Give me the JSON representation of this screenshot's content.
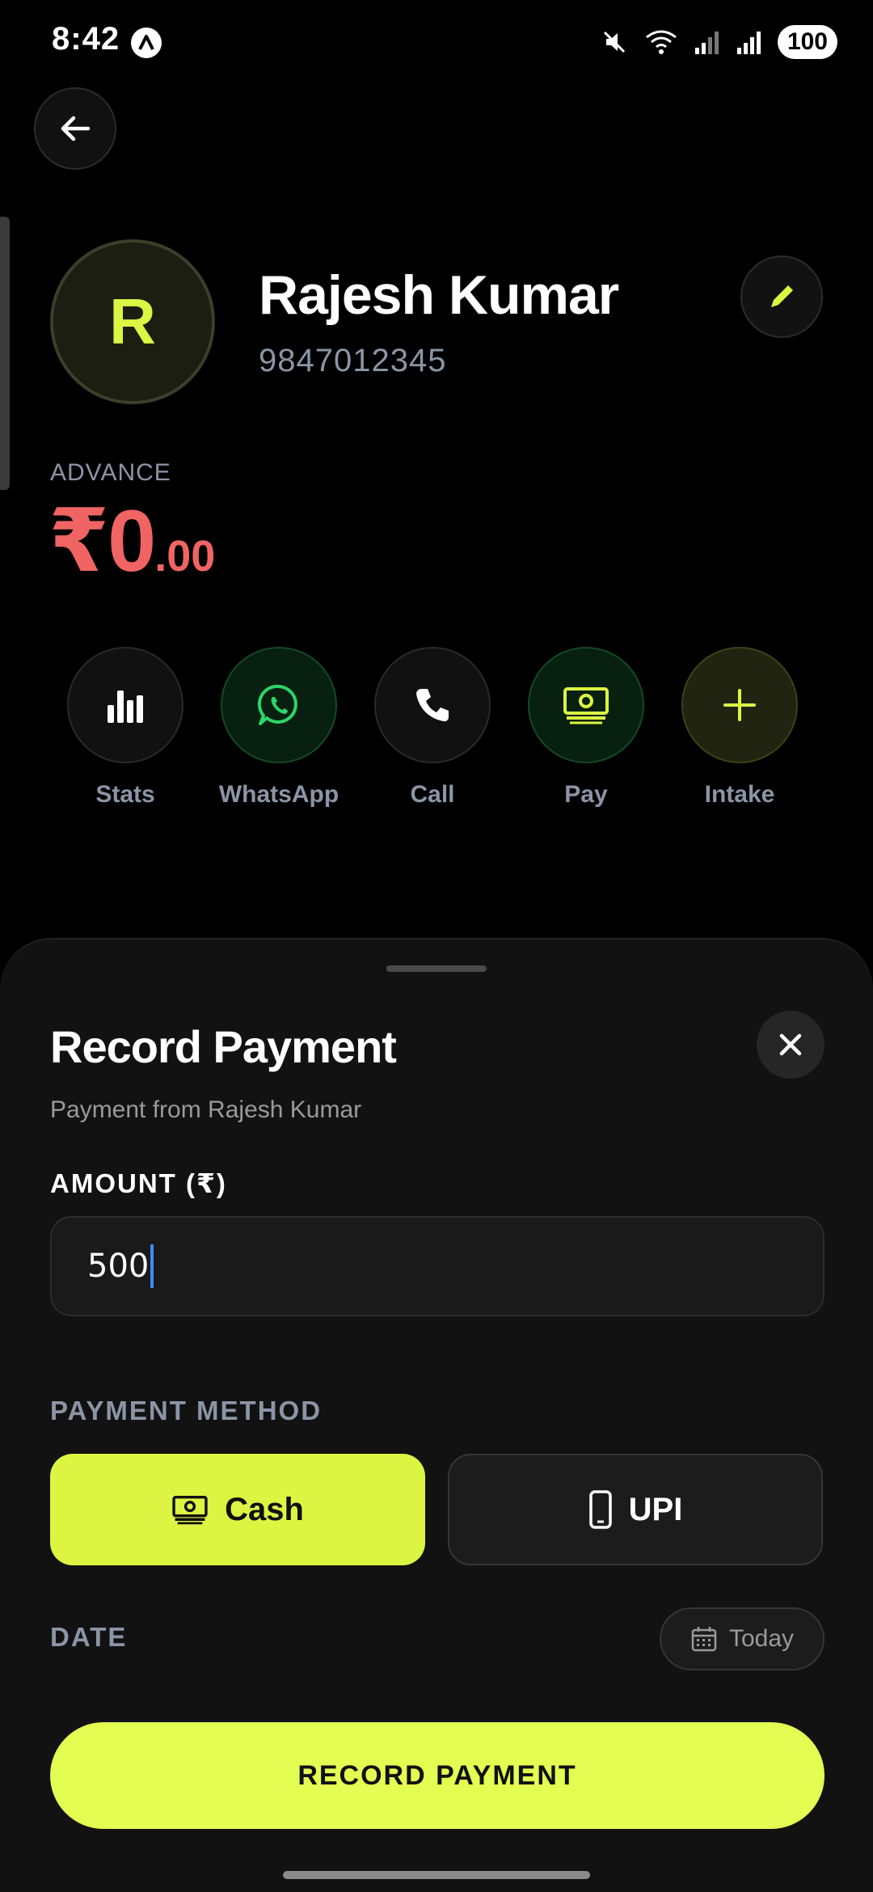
{
  "status_bar": {
    "time": "8:42",
    "battery": "100",
    "icons": [
      "mute-icon",
      "wifi-icon",
      "signal-icon",
      "signal-icon"
    ]
  },
  "customer": {
    "initial": "R",
    "name": "Rajesh Kumar",
    "phone": "9847012345"
  },
  "balance": {
    "label": "ADVANCE",
    "amount_main": "₹0",
    "amount_cents": ".00",
    "color": "#f06464"
  },
  "actions": [
    {
      "label": "Stats",
      "icon": "stats-icon"
    },
    {
      "label": "WhatsApp",
      "icon": "whatsapp-icon"
    },
    {
      "label": "Call",
      "icon": "phone-icon"
    },
    {
      "label": "Pay",
      "icon": "cash-icon"
    },
    {
      "label": "Intake",
      "icon": "plus-icon"
    }
  ],
  "sheet": {
    "title": "Record Payment",
    "subtitle": "Payment from Rajesh Kumar",
    "amount_label": "AMOUNT (₹)",
    "amount_value": "500",
    "method_label": "PAYMENT METHOD",
    "methods": [
      {
        "label": "Cash",
        "icon": "cash-icon",
        "selected": true
      },
      {
        "label": "UPI",
        "icon": "phone-outline-icon",
        "selected": false
      }
    ],
    "date_label": "DATE",
    "date_value": "Today",
    "submit_label": "RECORD PAYMENT"
  },
  "colors": {
    "accent": "#dcf542",
    "background": "#000000",
    "sheet": "#121212"
  }
}
